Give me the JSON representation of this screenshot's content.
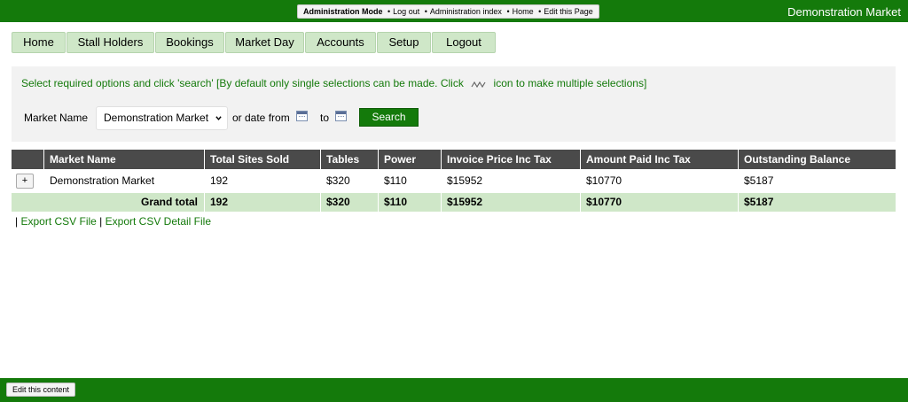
{
  "header": {
    "admin_mode": "Administration Mode",
    "links": [
      "Log out",
      "Administration index",
      "Home",
      "Edit this Page"
    ],
    "separator": "•",
    "site_name": "Demonstration Market"
  },
  "nav": {
    "tabs": [
      "Home",
      "Stall Holders",
      "Bookings",
      "Market Day",
      "Accounts",
      "Setup",
      "Logout"
    ]
  },
  "filters": {
    "hint_before": "Select required options and click 'search' [By default only single selections can be made. Click",
    "hint_after": "icon to make multiple selections]",
    "market_label": "Market Name",
    "market_value": "Demonstration Market",
    "date_from_label": "or date from",
    "to_label": "to",
    "search_label": "Search"
  },
  "table": {
    "headers": [
      "",
      "Market Name",
      "Total Sites Sold",
      "Tables",
      "Power",
      "Invoice Price Inc Tax",
      "Amount Paid Inc Tax",
      "Outstanding Balance"
    ],
    "rows": [
      {
        "expand": "+",
        "market": "Demonstration Market",
        "sites": "192",
        "tables": "$320",
        "power": "$110",
        "invoice": "$15952",
        "paid": "$10770",
        "balance": "$5187"
      }
    ],
    "total": {
      "label": "Grand total",
      "sites": "192",
      "tables": "$320",
      "power": "$110",
      "invoice": "$15952",
      "paid": "$10770",
      "balance": "$5187"
    }
  },
  "exports": {
    "separator": "|",
    "csv": "Export CSV File",
    "csv_detail": "Export CSV Detail File"
  },
  "footer": {
    "edit_label": "Edit this content"
  },
  "colors": {
    "brand_green": "#147a0b",
    "tab_green": "#cfe7c8",
    "header_dark": "#4a4a4a",
    "panel_grey": "#f2f2f2"
  }
}
